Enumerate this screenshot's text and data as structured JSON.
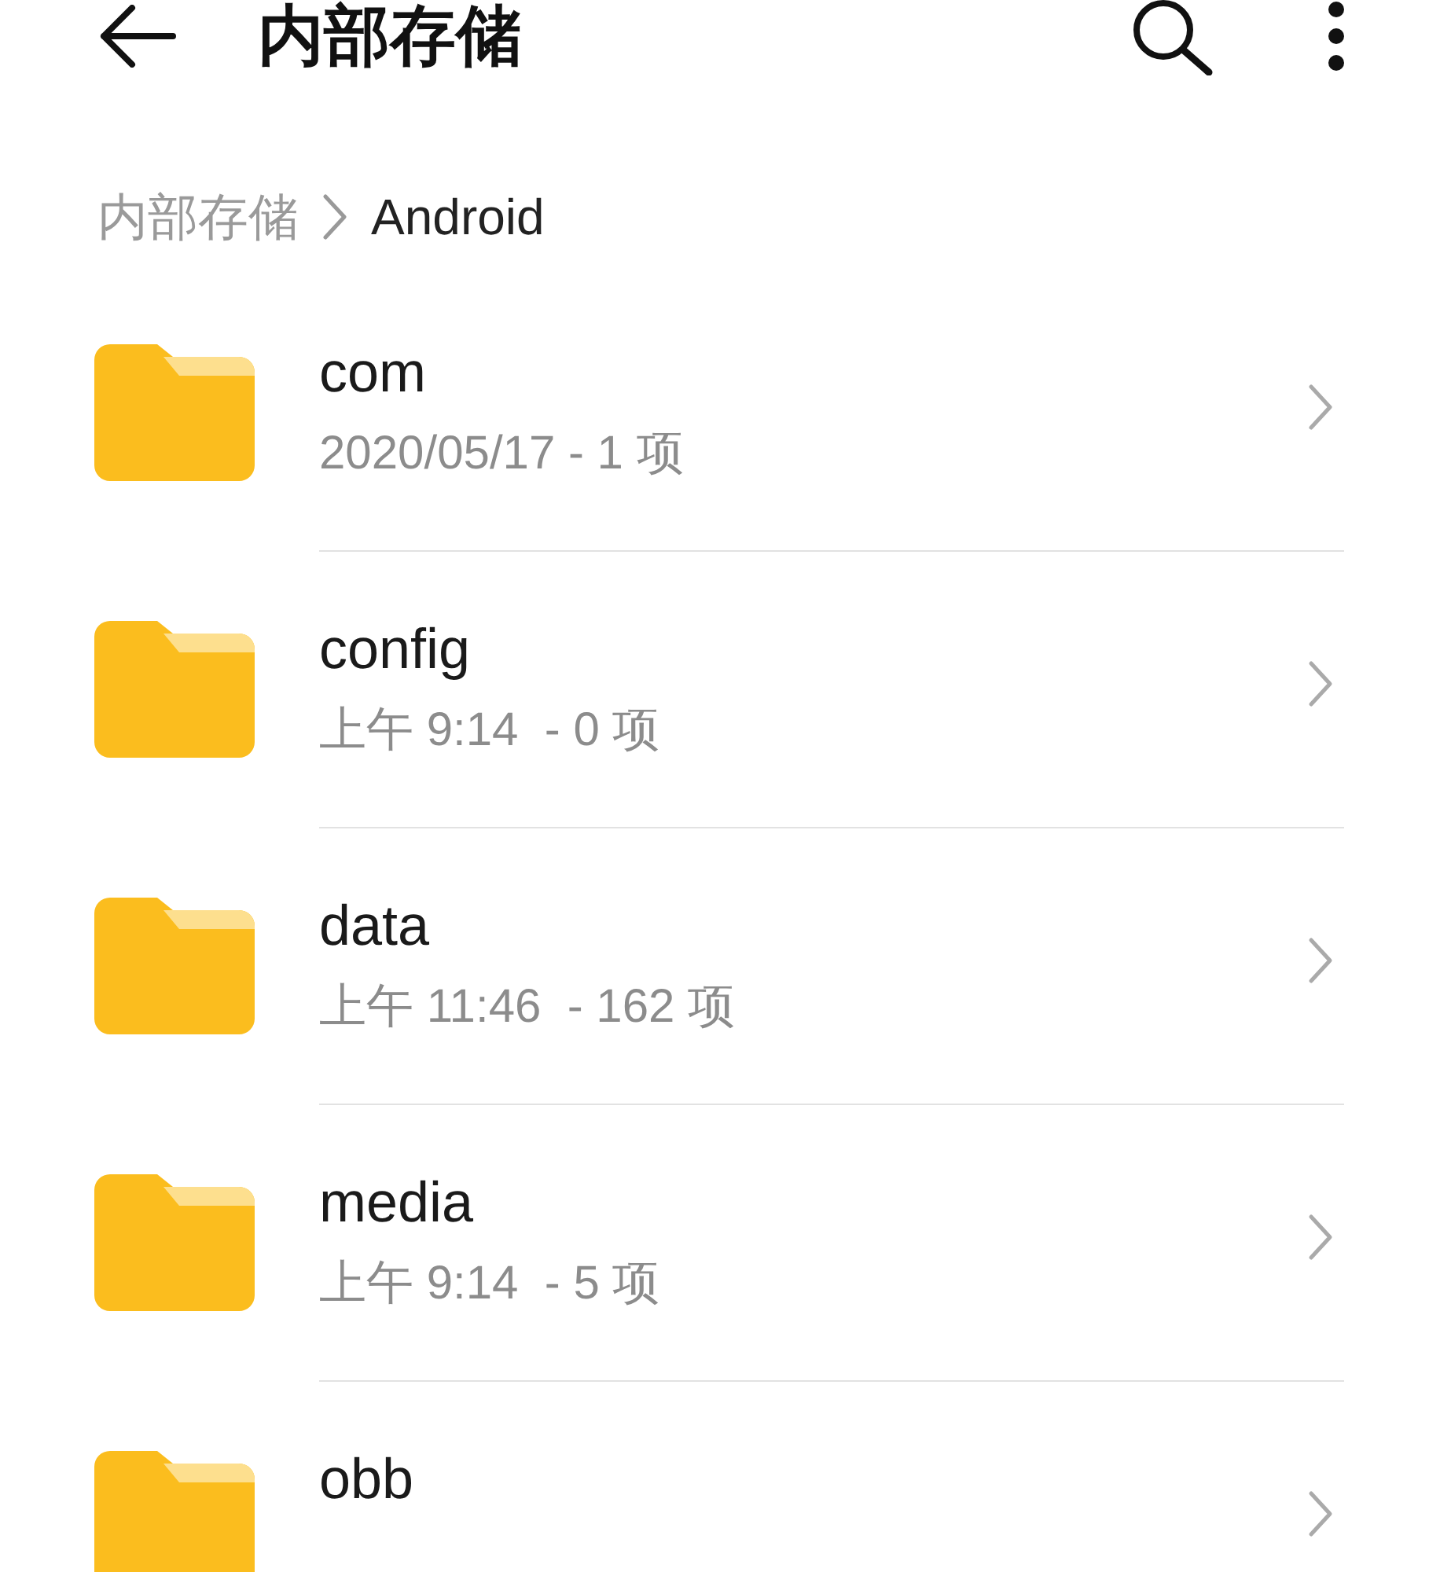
{
  "header": {
    "title": "内部存储"
  },
  "breadcrumb": [
    {
      "label": "内部存储",
      "selected": false
    },
    {
      "label": "Android",
      "selected": true
    }
  ],
  "folders": [
    {
      "name": "com",
      "details": "2020/05/17 - 1 项"
    },
    {
      "name": "config",
      "details": "上午 9:14  - 0 项"
    },
    {
      "name": "data",
      "details": "上午 11:46  - 162 项"
    },
    {
      "name": "media",
      "details": "上午 9:14  - 5 项"
    },
    {
      "name": "obb"
    }
  ]
}
